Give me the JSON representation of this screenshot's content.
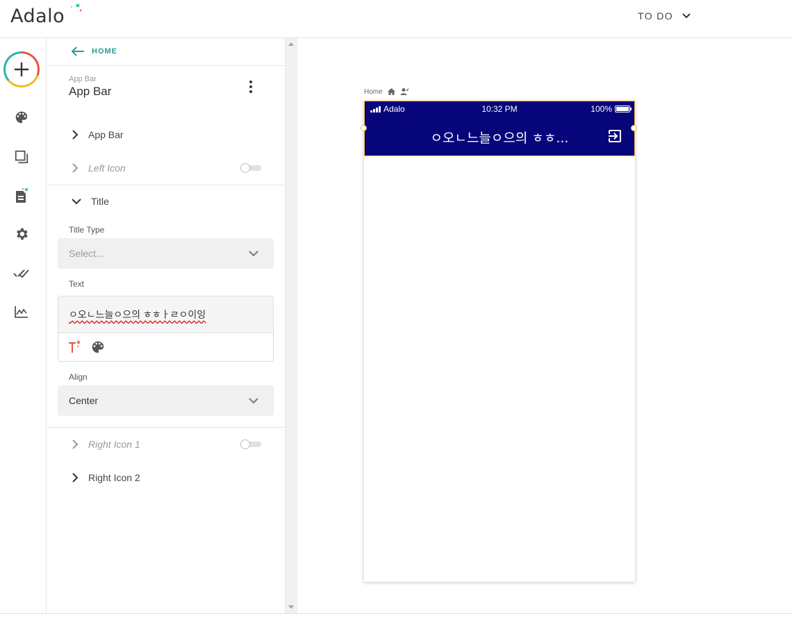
{
  "header": {
    "logo_text": "Adalo",
    "app_name": "TO DO"
  },
  "rail": {
    "items": [
      "add-component",
      "branding",
      "screens",
      "database",
      "settings",
      "publish",
      "analytics"
    ]
  },
  "panel": {
    "back_label": "HOME",
    "component_subtitle": "App Bar",
    "component_title": "App Bar",
    "sections": {
      "app_bar": "App Bar",
      "left_icon": "Left Icon",
      "title": "Title",
      "right_icon_1": "Right Icon 1",
      "right_icon_2": "Right Icon 2"
    },
    "toggles": {
      "left_icon": false,
      "right_icon_1": false
    },
    "title_type_label": "Title Type",
    "title_type_placeholder": "Select...",
    "text_label": "Text",
    "text_value": "ㅇ오ㄴ느늘ㅇ으의 ㅎㅎㅏㄹㅇ이잉",
    "align_label": "Align",
    "align_value": "Center"
  },
  "canvas": {
    "screen_name": "Home",
    "status": {
      "carrier": "Adalo",
      "time": "10:32 PM",
      "battery": "100%"
    },
    "appbar_title": "ㅇ오ㄴ느늘ㅇ으의 ㅎㅎ...",
    "appbar_color": "#07057a",
    "selection_color": "#f2b94a"
  },
  "colors": {
    "accent": "#2b9c91",
    "brand_red": "#e8553e",
    "brand_yellow": "#f6b81c"
  }
}
